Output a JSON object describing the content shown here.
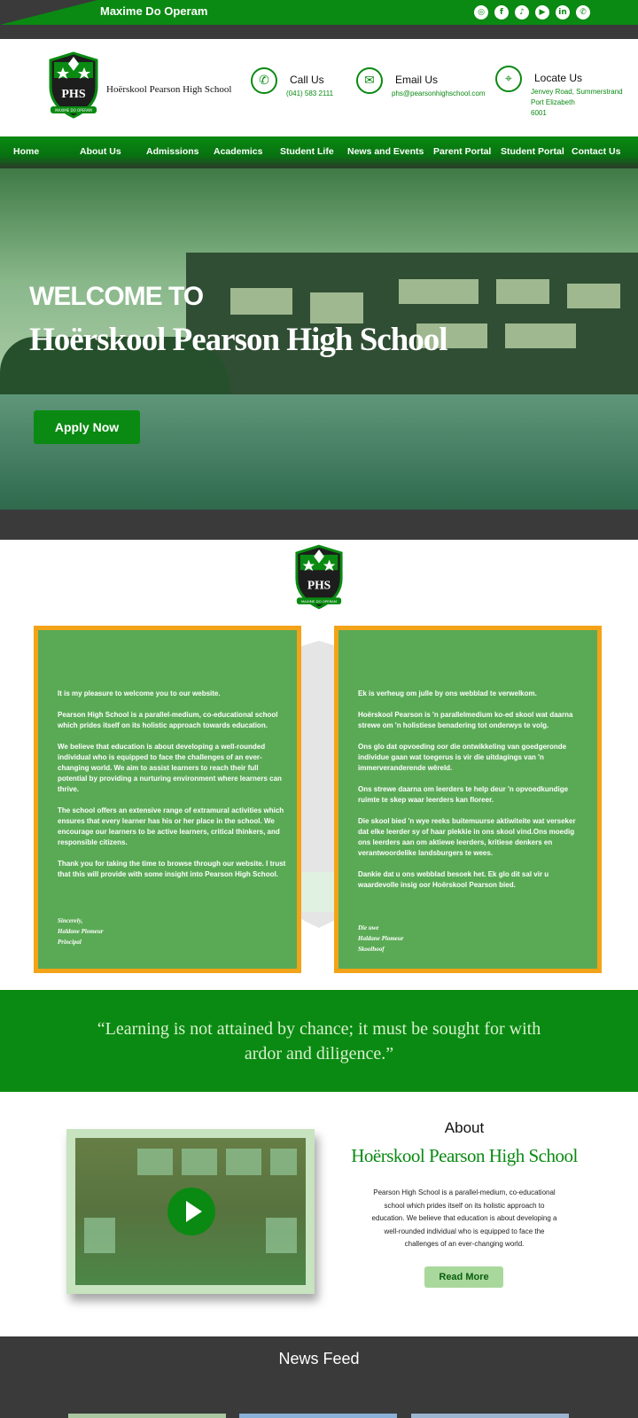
{
  "topbar": {
    "motto": "Maxime Do Operam",
    "socials": [
      {
        "icon": "instagram-icon",
        "glyph": "◎"
      },
      {
        "icon": "facebook-icon",
        "glyph": "f"
      },
      {
        "icon": "tiktok-icon",
        "glyph": "♪"
      },
      {
        "icon": "youtube-icon",
        "glyph": "▶"
      },
      {
        "icon": "linkedin-icon",
        "glyph": "in"
      },
      {
        "icon": "whatsapp-icon",
        "glyph": "✆"
      }
    ]
  },
  "header": {
    "school_name": "Hoërskool Pearson High School",
    "crest_motto": "MAXIME DO OPERAM",
    "crest_letters": "PHS",
    "call": {
      "label": "Call Us",
      "value": "(041) 583 2111"
    },
    "email": {
      "label": "Email Us",
      "value": "phs@pearsonhighschool.com"
    },
    "locate": {
      "label": "Locate Us",
      "value_1": "Jenvey Road, Summerstrand",
      "value_2": "Port Elizabeth",
      "value_3": "6001"
    }
  },
  "nav": {
    "items": [
      "Home",
      "About Us",
      "Admissions",
      "Academics",
      "Student Life",
      "News and Events",
      "Parent Portal",
      "Student Portal",
      "Contact Us"
    ]
  },
  "hero": {
    "welcome": "WELCOME TO",
    "title": "Hoërskool Pearson High School",
    "cta": "Apply Now"
  },
  "messages": {
    "english": {
      "paragraphs": [
        "It is my pleasure to welcome you to our website.",
        "Pearson High School is a parallel-medium, co-educational school which prides itself on its holistic approach towards education.",
        "We believe that education is about developing a well-rounded individual who is equipped to face the challenges of an ever-changing world. We aim to assist learners to reach their full potential by providing a nurturing environment where learners can thrive.",
        "The school offers an extensive range of extramural activities which ensures that every learner has his or her place in the school. We encourage our learners to be active learners, critical thinkers, and responsible citizens.",
        "Thank you for taking the time to browse through our website. I trust that this will provide with some insight into Pearson High School."
      ],
      "sign": [
        "Sincerely,",
        "Haldane Plomeur",
        "Principal"
      ]
    },
    "afrikaans": {
      "paragraphs": [
        "Ek is verheug om julle by ons webblad te verwelkom.",
        "Hoërskool Pearson is 'n parallelmedium ko-ed skool wat daarna strewe om 'n holistiese benadering tot onderwys te volg.",
        "Ons glo dat opvoeding oor die ontwikkeling van goedgeronde individue gaan wat toegerus is vir die uitdagings van 'n immerveranderende wêreld.",
        "Ons strewe daarna om leerders te help deur 'n opvoedkundige ruimte te skep waar leerders kan floreer.",
        "Die skool bied 'n wye reeks buitemuurse aktiwiteite wat verseker dat elke leerder sy of haar plekkie in ons skool vind.Ons moedig ons leerders aan om aktiewe leerders, kritiese denkers en verantwoordelike landsburgers te wees.",
        "Dankie dat u ons webblad besoek het. Ek glo dit sal vir u waardevolle insig oor Hoërskool Pearson bied."
      ],
      "sign": [
        "Die uwe",
        "Haldane Plomeur",
        "Skoolhoof"
      ]
    }
  },
  "quote": {
    "text": "“Learning is not attained by chance; it must be sought for with ardor and diligence.”"
  },
  "about": {
    "heading": "About",
    "subheading": "Hoërskool Pearson High School",
    "text": "Pearson High School is a parallel-medium, co-educational school which prides itself on its holistic approach to education. We believe that education is about developing a well-rounded individual who is equipped to face the challenges of an ever-changing world.",
    "cta": "Read More"
  },
  "news": {
    "heading": "News Feed"
  },
  "colors": {
    "brand_green": "#0a8a12",
    "accent_orange": "#f3a317",
    "card_green": "#5aaa55",
    "dark": "#3a3a3a"
  }
}
